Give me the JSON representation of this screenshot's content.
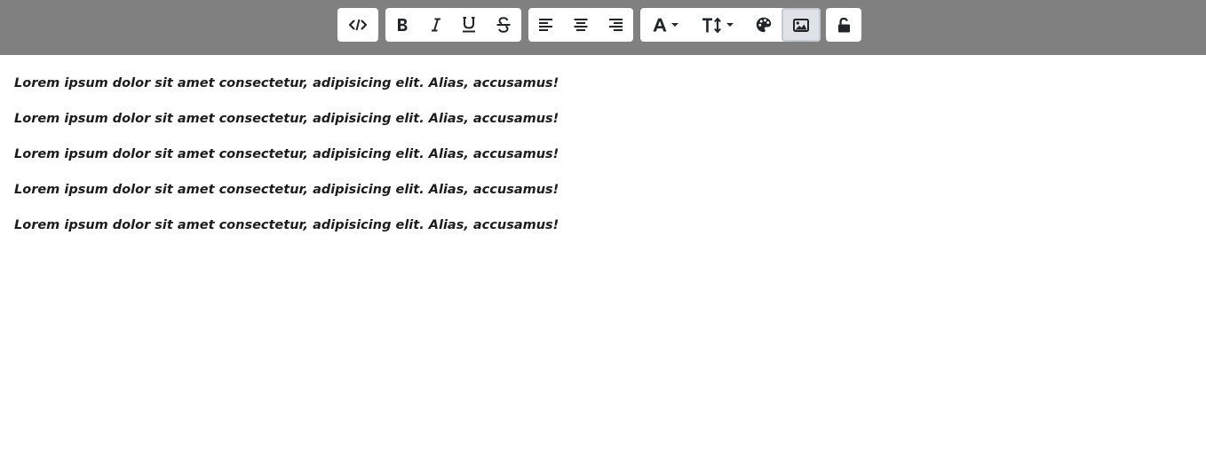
{
  "toolbar": {
    "buttons": {
      "code": {
        "icon": "code-icon"
      },
      "bold": {
        "icon": "bold-icon"
      },
      "italic": {
        "icon": "italic-icon"
      },
      "underline": {
        "icon": "underline-icon"
      },
      "strikethrough": {
        "icon": "strikethrough-icon"
      },
      "align_left": {
        "icon": "align-left-icon"
      },
      "align_center": {
        "icon": "align-center-icon"
      },
      "align_right": {
        "icon": "align-right-icon"
      },
      "font_color": {
        "icon": "font-color-icon",
        "dropdown": true
      },
      "font_size": {
        "icon": "text-height-icon",
        "dropdown": true
      },
      "palette": {
        "icon": "palette-icon"
      },
      "image": {
        "icon": "image-icon",
        "active": true
      },
      "lock": {
        "icon": "unlock-icon"
      }
    },
    "background_color": "#808080"
  },
  "editor": {
    "lines": [
      "Lorem ipsum dolor sit amet consectetur, adipisicing elit. Alias, accusamus!",
      "Lorem ipsum dolor sit amet consectetur, adipisicing elit. Alias, accusamus!",
      "Lorem ipsum dolor sit amet consectetur, adipisicing elit. Alias, accusamus!",
      "Lorem ipsum dolor sit amet consectetur, adipisicing elit. Alias, accusamus!",
      "Lorem ipsum dolor sit amet consectetur, adipisicing elit. Alias, accusamus!"
    ]
  }
}
